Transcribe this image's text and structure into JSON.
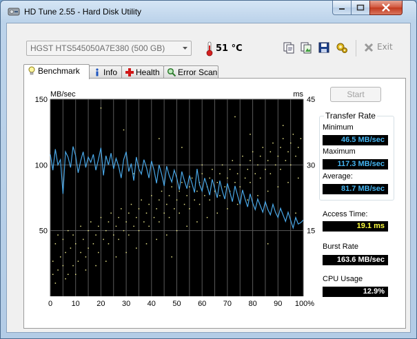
{
  "window": {
    "title": "HD Tune 2.55 - Hard Disk Utility"
  },
  "toolbar": {
    "drive": "HGST HTS545050A7E380 (500 GB)",
    "temperature": "51 °C",
    "exit_label": "Exit",
    "icons": [
      "copy-text-icon",
      "copy-image-icon",
      "save-icon",
      "options-icon",
      "exit-icon"
    ]
  },
  "tabs": [
    {
      "label": "Benchmark",
      "icon": "lightbulb-icon",
      "active": true
    },
    {
      "label": "Info",
      "icon": "info-icon",
      "active": false
    },
    {
      "label": "Health",
      "icon": "health-cross-icon",
      "active": false
    },
    {
      "label": "Error Scan",
      "icon": "magnifier-icon",
      "active": false
    }
  ],
  "benchmark": {
    "start_label": "Start",
    "transfer_rate_title": "Transfer Rate",
    "minimum_label": "Minimum",
    "minimum_value": "46.5 MB/sec",
    "maximum_label": "Maximum",
    "maximum_value": "117.3 MB/sec",
    "average_label": "Average:",
    "average_value": "81.7 MB/sec",
    "access_time_label": "Access Time:",
    "access_time_value": "19.1 ms",
    "burst_rate_label": "Burst Rate",
    "burst_rate_value": "163.6 MB/sec",
    "cpu_usage_label": "CPU Usage",
    "cpu_usage_value": "12.9%"
  },
  "colors": {
    "transfer_line": "#4aa8e8",
    "access_points": "#e8e48a",
    "value_blue": "#45b4f0",
    "value_yellow": "#ffff40",
    "value_white": "#ffffff"
  },
  "chart_data": {
    "type": "line",
    "ylabel_left": "MB/sec",
    "ylabel_right": "ms",
    "y_left_ticks": [
      "150",
      "100",
      "50"
    ],
    "y_right_ticks": [
      "45",
      "30",
      "15"
    ],
    "ylim_left": [
      0,
      150
    ],
    "ylim_right": [
      0,
      45
    ],
    "x_ticks": [
      "0",
      "10",
      "20",
      "30",
      "40",
      "50",
      "60",
      "70",
      "80",
      "90",
      "100%"
    ],
    "xlim": [
      0,
      100
    ],
    "grid": true,
    "series": [
      {
        "axis": "left",
        "x": [
          0,
          1,
          2,
          3,
          4,
          5,
          6,
          7,
          8,
          9,
          10,
          11,
          12,
          13,
          14,
          15,
          16,
          17,
          18,
          19,
          20,
          21,
          22,
          23,
          24,
          25,
          26,
          27,
          28,
          29,
          30,
          31,
          32,
          33,
          34,
          35,
          36,
          37,
          38,
          39,
          40,
          41,
          42,
          43,
          44,
          45,
          46,
          47,
          48,
          49,
          50,
          51,
          52,
          53,
          54,
          55,
          56,
          57,
          58,
          59,
          60,
          61,
          62,
          63,
          64,
          65,
          66,
          67,
          68,
          69,
          70,
          71,
          72,
          73,
          74,
          75,
          76,
          77,
          78,
          79,
          80,
          81,
          82,
          83,
          84,
          85,
          86,
          87,
          88,
          89,
          90,
          91,
          92,
          93,
          94,
          95,
          96,
          97,
          98,
          99,
          100
        ],
        "values": [
          108,
          96,
          112,
          100,
          104,
          78,
          110,
          106,
          98,
          114,
          107,
          94,
          103,
          110,
          98,
          106,
          102,
          108,
          96,
          104,
          113,
          92,
          107,
          100,
          109,
          97,
          105,
          99,
          90,
          104,
          110,
          95,
          101,
          88,
          106,
          97,
          93,
          104,
          98,
          90,
          103,
          96,
          86,
          100,
          93,
          84,
          99,
          92,
          87,
          96,
          90,
          81,
          95,
          88,
          82,
          92,
          86,
          79,
          97,
          85,
          80,
          90,
          84,
          77,
          89,
          82,
          75,
          88,
          80,
          74,
          86,
          79,
          72,
          84,
          77,
          70,
          81,
          74,
          68,
          78,
          71,
          66,
          74,
          69,
          64,
          72,
          66,
          62,
          70,
          64,
          60,
          67,
          62,
          57,
          64,
          58,
          52,
          60,
          55,
          56,
          58
        ]
      }
    ],
    "scatter_points_right_axis": [
      [
        1,
        8
      ],
      [
        1,
        5
      ],
      [
        2,
        12
      ],
      [
        3,
        6
      ],
      [
        3,
        14
      ],
      [
        4,
        9
      ],
      [
        5,
        7
      ],
      [
        5,
        13
      ],
      [
        6,
        10
      ],
      [
        7,
        5
      ],
      [
        7,
        15
      ],
      [
        8,
        11
      ],
      [
        9,
        7
      ],
      [
        9,
        14
      ],
      [
        10,
        12
      ],
      [
        11,
        8
      ],
      [
        12,
        16
      ],
      [
        12,
        10
      ],
      [
        13,
        13
      ],
      [
        14,
        9
      ],
      [
        15,
        15
      ],
      [
        15,
        11
      ],
      [
        16,
        17
      ],
      [
        17,
        12
      ],
      [
        18,
        14
      ],
      [
        19,
        16
      ],
      [
        19,
        10
      ],
      [
        20,
        18
      ],
      [
        21,
        13
      ],
      [
        22,
        15
      ],
      [
        23,
        17
      ],
      [
        23,
        12
      ],
      [
        24,
        19
      ],
      [
        25,
        14
      ],
      [
        26,
        16
      ],
      [
        27,
        18
      ],
      [
        27,
        13
      ],
      [
        28,
        20
      ],
      [
        29,
        15
      ],
      [
        30,
        17
      ],
      [
        31,
        19
      ],
      [
        31,
        14
      ],
      [
        32,
        21
      ],
      [
        33,
        16
      ],
      [
        34,
        18
      ],
      [
        35,
        20
      ],
      [
        35,
        15
      ],
      [
        36,
        22
      ],
      [
        37,
        17
      ],
      [
        38,
        19
      ],
      [
        39,
        21
      ],
      [
        39,
        16
      ],
      [
        40,
        23
      ],
      [
        41,
        18
      ],
      [
        42,
        20
      ],
      [
        43,
        22
      ],
      [
        43,
        17
      ],
      [
        44,
        24
      ],
      [
        45,
        19
      ],
      [
        46,
        21
      ],
      [
        47,
        23
      ],
      [
        47,
        18
      ],
      [
        48,
        25
      ],
      [
        49,
        20
      ],
      [
        50,
        22
      ],
      [
        51,
        24
      ],
      [
        51,
        19
      ],
      [
        52,
        26
      ],
      [
        53,
        21
      ],
      [
        54,
        23
      ],
      [
        55,
        25
      ],
      [
        55,
        20
      ],
      [
        56,
        27
      ],
      [
        57,
        22
      ],
      [
        58,
        24
      ],
      [
        59,
        26
      ],
      [
        59,
        21
      ],
      [
        60,
        28
      ],
      [
        61,
        23
      ],
      [
        62,
        25
      ],
      [
        63,
        27
      ],
      [
        63,
        22
      ],
      [
        64,
        29
      ],
      [
        65,
        24
      ],
      [
        66,
        26
      ],
      [
        67,
        28
      ],
      [
        67,
        23
      ],
      [
        68,
        30
      ],
      [
        69,
        25
      ],
      [
        70,
        27
      ],
      [
        71,
        29
      ],
      [
        71,
        24
      ],
      [
        72,
        31
      ],
      [
        73,
        26
      ],
      [
        74,
        28
      ],
      [
        75,
        30
      ],
      [
        75,
        25
      ],
      [
        76,
        32
      ],
      [
        77,
        27
      ],
      [
        78,
        29
      ],
      [
        79,
        31
      ],
      [
        79,
        26
      ],
      [
        80,
        33
      ],
      [
        81,
        28
      ],
      [
        82,
        30
      ],
      [
        83,
        32
      ],
      [
        83,
        27
      ],
      [
        84,
        34
      ],
      [
        85,
        29
      ],
      [
        86,
        31
      ],
      [
        87,
        33
      ],
      [
        87,
        28
      ],
      [
        88,
        35
      ],
      [
        89,
        30
      ],
      [
        90,
        32
      ],
      [
        91,
        34
      ],
      [
        91,
        29
      ],
      [
        92,
        36
      ],
      [
        93,
        31
      ],
      [
        94,
        33
      ],
      [
        95,
        35
      ],
      [
        95,
        30
      ],
      [
        96,
        37
      ],
      [
        97,
        32
      ],
      [
        98,
        34
      ],
      [
        99,
        36
      ],
      [
        2,
        3
      ],
      [
        6,
        4
      ],
      [
        10,
        5
      ],
      [
        14,
        6
      ],
      [
        18,
        7
      ],
      [
        22,
        8
      ],
      [
        26,
        9
      ],
      [
        30,
        10
      ],
      [
        34,
        11
      ],
      [
        38,
        12
      ],
      [
        42,
        13
      ],
      [
        46,
        14
      ],
      [
        50,
        15
      ],
      [
        54,
        16
      ],
      [
        58,
        17
      ],
      [
        62,
        18
      ],
      [
        66,
        19
      ],
      [
        70,
        20
      ],
      [
        74,
        21
      ],
      [
        78,
        22
      ],
      [
        82,
        23
      ],
      [
        86,
        24
      ],
      [
        90,
        25
      ],
      [
        94,
        26
      ],
      [
        98,
        27
      ],
      [
        20,
        43
      ],
      [
        29,
        38
      ],
      [
        33,
        28
      ],
      [
        43,
        36
      ],
      [
        48,
        9
      ],
      [
        52,
        34
      ],
      [
        60,
        30
      ],
      [
        73,
        41
      ],
      [
        79,
        37
      ],
      [
        86,
        12
      ],
      [
        92,
        39
      ],
      [
        97,
        19
      ]
    ]
  }
}
